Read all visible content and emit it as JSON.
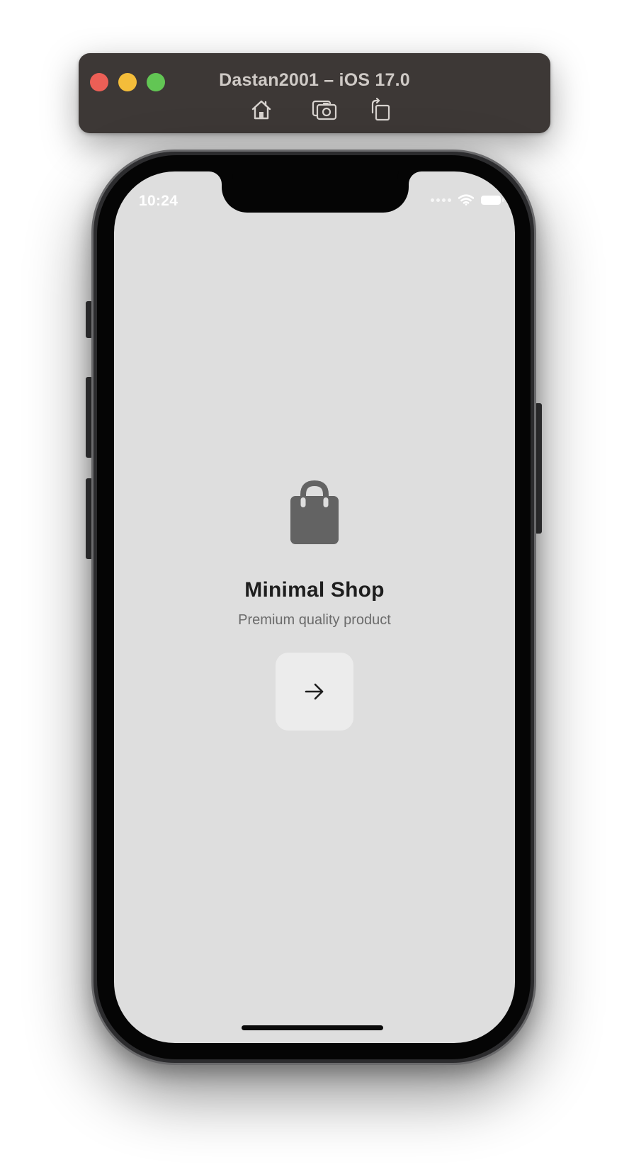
{
  "simulator": {
    "title": "Dastan2001 – iOS 17.0",
    "window_controls": {
      "close_color": "#ec5f56",
      "minimize_color": "#f4bd3a",
      "zoom_color": "#62c654"
    },
    "toolbar_icons": [
      "home-icon",
      "screenshot-icon",
      "rotate-icon"
    ]
  },
  "status_bar": {
    "time": "10:24",
    "icons": [
      "cellular-signal-icon",
      "wifi-icon",
      "battery-icon"
    ]
  },
  "app": {
    "icon": "shopping-bag-icon",
    "title": "Minimal Shop",
    "subtitle": "Premium quality product",
    "next_button_icon": "arrow-right-icon"
  },
  "colors": {
    "screen_background": "#dedede",
    "icon_gray": "#636363",
    "title_text": "#1e1e1e",
    "subtitle_text": "#6b6b6b",
    "button_background": "#ececec"
  }
}
